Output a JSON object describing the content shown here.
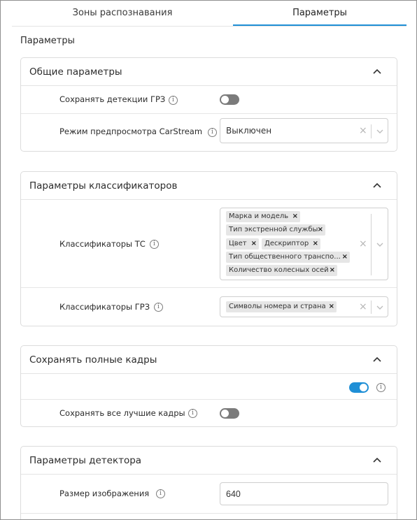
{
  "tabs": [
    {
      "label": "Зоны распознавания",
      "active": false
    },
    {
      "label": "Параметры",
      "active": true
    }
  ],
  "page_title": "Параметры",
  "colors": {
    "accent": "#1f8fd6",
    "toggle_off": "#7b7b7b",
    "chip_bg": "#e6e6e6"
  },
  "general": {
    "title": "Общие параметры",
    "save_lpr_label": "Сохранять детекции ГРЗ",
    "save_lpr_on": false,
    "preview_label": "Режим предпросмотра CarStream",
    "preview_value": "Выключен"
  },
  "classifiers": {
    "title": "Параметры классификаторов",
    "vehicle_label": "Классификаторы ТС",
    "vehicle_chips": [
      "Марка и модель",
      "Тип экстренной службы",
      "Цвет",
      "Дескриптор",
      "Тип общественного транспо...",
      "Количество колесных осей"
    ],
    "plate_label": "Классификаторы ГРЗ",
    "plate_chips": [
      "Символы номера и страна"
    ]
  },
  "full_frames": {
    "title": "Сохранять полные кадры",
    "enabled": true,
    "best_frames_label": "Сохранять все лучшие кадры",
    "best_frames_on": false
  },
  "detector": {
    "title": "Параметры детектора",
    "image_size_label": "Размер изображения",
    "image_size_value": "640"
  },
  "icons": {
    "info": "info-icon",
    "chevron_up": "chevron-up-icon",
    "chevron_down": "chevron-down-icon",
    "clear": "clear-icon",
    "chip_remove": "close-icon"
  }
}
